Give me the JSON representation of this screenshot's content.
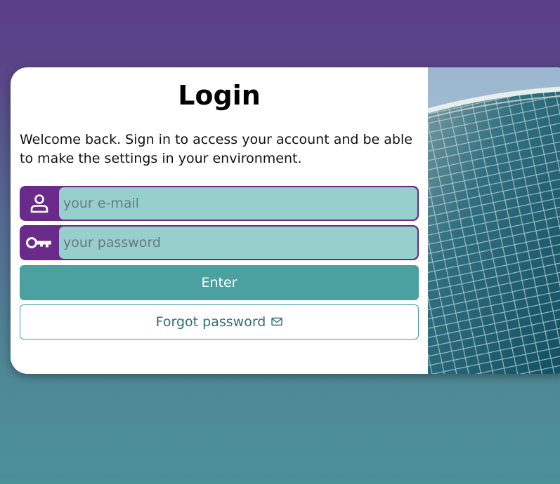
{
  "login": {
    "title": "Login",
    "welcome": "Welcome back. Sign in to access your account and be able to make the settings in your environment.",
    "email_placeholder": "your e-mail",
    "password_placeholder": "your password",
    "enter_label": "Enter",
    "forgot_label": "Forgot password"
  },
  "icons": {
    "email": "user-icon",
    "password": "key-icon",
    "forgot": "envelope-icon"
  },
  "colors": {
    "background_top": "#5b3f88",
    "background_bottom": "#4b9198",
    "input_group": "#6a2a8a",
    "input_fill": "#96cfcc",
    "enter_button": "#4aa19f",
    "forgot_border": "#4a9a98"
  }
}
